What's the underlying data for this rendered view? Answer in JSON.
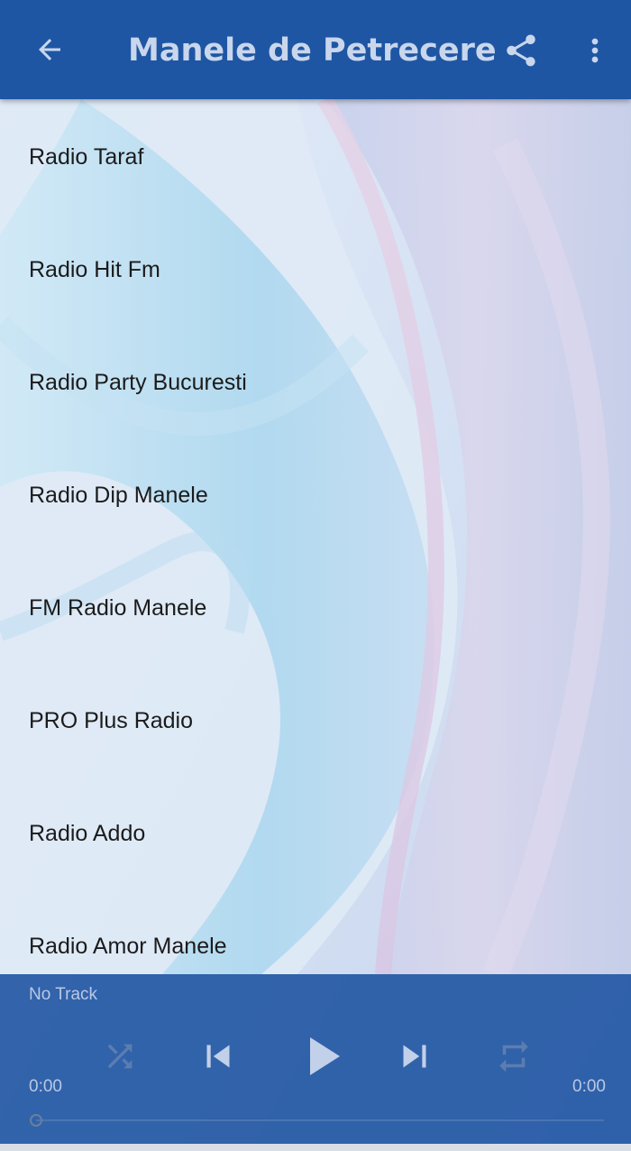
{
  "app_bar": {
    "title": "Manele de Petrecere",
    "back_icon": "arrow-left-icon",
    "share_icon": "share-icon",
    "more_icon": "more-vert-icon",
    "color": "#1e56a4",
    "title_color": "#c9d6ec"
  },
  "stations": [
    {
      "label": "Radio Taraf"
    },
    {
      "label": "Radio Hit Fm"
    },
    {
      "label": "Radio Party Bucuresti"
    },
    {
      "label": "Radio Dip Manele"
    },
    {
      "label": "FM Radio Manele"
    },
    {
      "label": "PRO Plus Radio"
    },
    {
      "label": "Radio Addo"
    },
    {
      "label": "Radio Amor Manele"
    }
  ],
  "player": {
    "track": "No Track",
    "elapsed": "0:00",
    "total": "0:00",
    "progress": 0,
    "controls": {
      "shuffle_icon": "shuffle-icon",
      "previous_icon": "skip-previous-icon",
      "play_icon": "play-icon",
      "next_icon": "skip-next-icon",
      "repeat_icon": "repeat-icon"
    }
  }
}
